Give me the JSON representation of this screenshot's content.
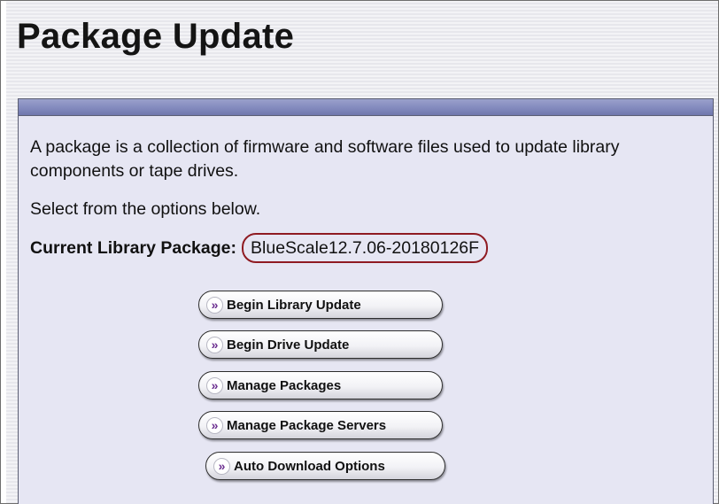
{
  "page": {
    "title": "Package Update"
  },
  "content": {
    "description": "A package is a collection of firmware and software files used to update library components or tape drives.",
    "select_prompt": "Select from the options below.",
    "current_package_label": "Current Library Package:",
    "current_package_value": "BlueScale12.7.06-20180126F"
  },
  "actions": [
    {
      "label": "Begin Library Update",
      "icon": "double-chevron-right-icon"
    },
    {
      "label": "Begin Drive Update",
      "icon": "double-chevron-right-icon"
    },
    {
      "label": "Manage Packages",
      "icon": "double-chevron-right-icon"
    },
    {
      "label": "Manage Package Servers",
      "icon": "double-chevron-right-icon"
    },
    {
      "label": "Auto Download Options",
      "icon": "double-chevron-right-icon"
    }
  ],
  "colors": {
    "panel_background": "#e6e6f3",
    "panel_header": "#858cbf",
    "highlight_border": "#8f1b22",
    "chevron": "#6a2d8f"
  }
}
